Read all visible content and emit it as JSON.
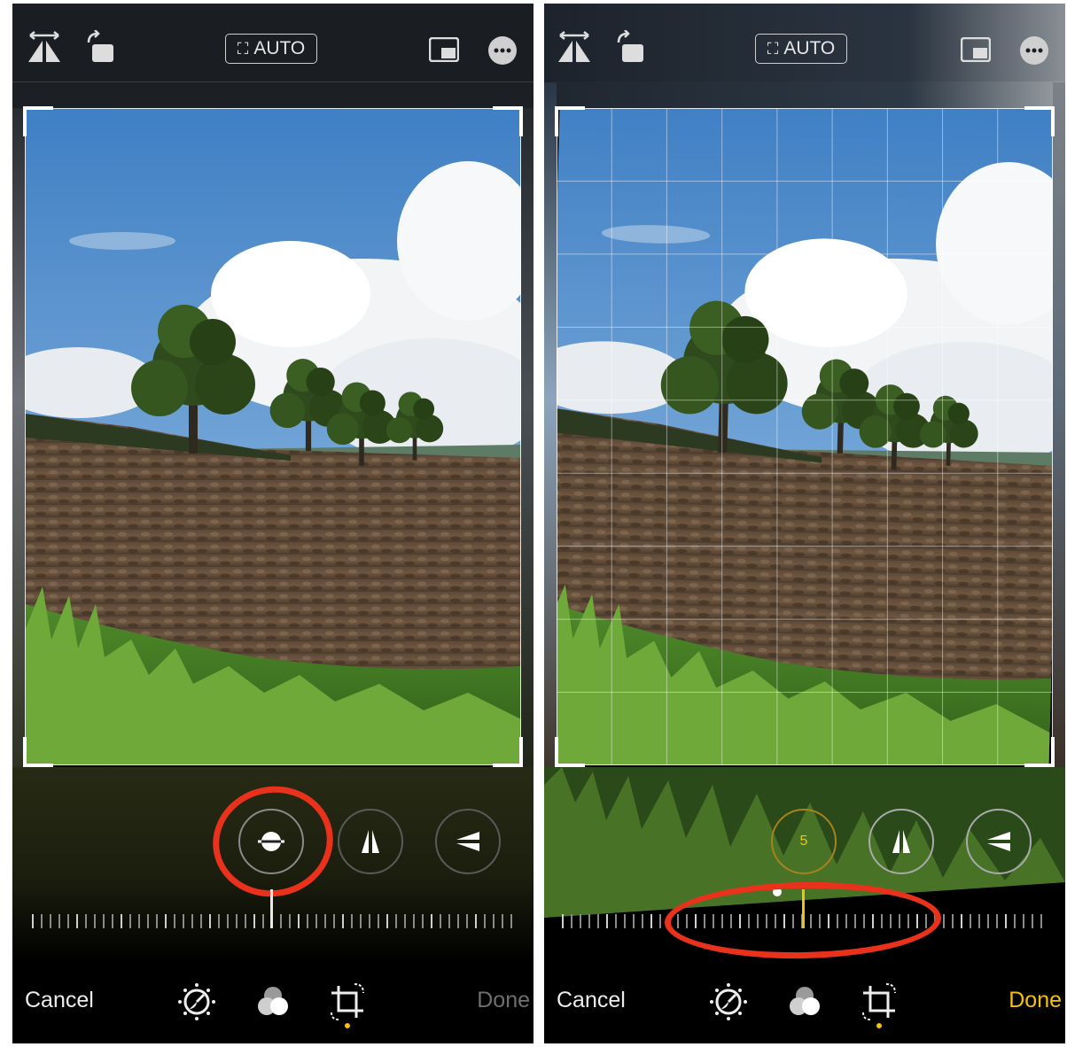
{
  "left_screen": {
    "auto_label": "AUTO",
    "cancel_label": "Cancel",
    "done_label": "Done",
    "done_color": "#6f6f6f",
    "active_adjustment": "straighten",
    "straighten_value": "",
    "grid_visible": false
  },
  "right_screen": {
    "auto_label": "AUTO",
    "cancel_label": "Cancel",
    "done_label": "Done",
    "done_color": "#f4c20d",
    "active_adjustment": "straighten",
    "straighten_value": "5",
    "grid_visible": true
  },
  "icons": {
    "flip": "flip-horizontal-icon",
    "rotate": "rotate-icon",
    "aspect": "aspect-ratio-icon",
    "more": "more-options-icon",
    "straighten": "straighten-icon",
    "vertical": "vertical-perspective-icon",
    "horizontal": "horizontal-perspective-icon",
    "adjust": "adjust-dial-icon",
    "filters": "filters-icon",
    "crop": "crop-rotate-icon"
  },
  "colors": {
    "accent_yellow": "#f4c20d",
    "highlight_red": "#e8321c"
  }
}
